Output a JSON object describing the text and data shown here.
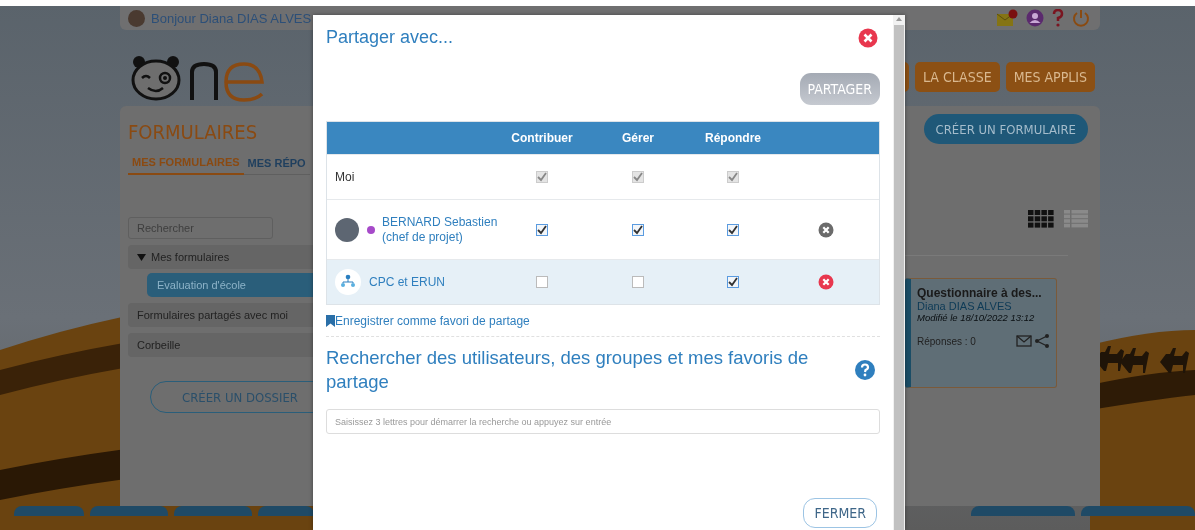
{
  "header": {
    "greeting": "Bonjour Diana DIAS ALVES"
  },
  "nav": [
    {
      "label": "LA CLASSE"
    },
    {
      "label": "MES APPLIS"
    }
  ],
  "app": {
    "title": "FORMULAIRES",
    "tabs": [
      {
        "label": "MES FORMULAIRES",
        "selected": true
      },
      {
        "label": "MES RÉPO",
        "selected": false
      }
    ],
    "search": {
      "placeholder": "Rechercher"
    },
    "tree": [
      {
        "label": "Mes formulaires",
        "expanded": true,
        "selected": false,
        "children": [
          {
            "label": "Evaluation d'école",
            "selected": true
          }
        ]
      },
      {
        "label": "Formulaires partagés avec moi",
        "selected": false
      },
      {
        "label": "Corbeille",
        "selected": false
      }
    ],
    "create_folder": "CRÉER UN DOSSIER",
    "create_form": "CRÉER UN FORMULAIRE",
    "view_modes": [
      {
        "kind": "grid",
        "selected": true
      },
      {
        "kind": "list",
        "selected": false
      }
    ],
    "cards": [
      {
        "title": "Questionnaire à des...",
        "author": "Diana DIAS ALVES",
        "modified": "Modifié le 18/10/2022 13:12",
        "responses": "Réponses : 0"
      }
    ]
  },
  "dialog": {
    "title": "Partager avec...",
    "share_button": "PARTAGER",
    "columns": [
      "Contribuer",
      "Gérer",
      "Répondre"
    ],
    "rows": [
      {
        "kind": "self",
        "name": "Moi",
        "highlighted": false,
        "removable": false,
        "rights": [
          {
            "checked": true,
            "disabled": true
          },
          {
            "checked": true,
            "disabled": true
          },
          {
            "checked": true,
            "disabled": true
          }
        ]
      },
      {
        "kind": "user",
        "name": "BERNARD Sebastien (chef de projet)",
        "color": "#a64ac9",
        "highlighted": false,
        "removable": true,
        "rights": [
          {
            "checked": true,
            "disabled": false
          },
          {
            "checked": true,
            "disabled": false
          },
          {
            "checked": true,
            "disabled": false
          }
        ]
      },
      {
        "kind": "group",
        "name": "CPC et ERUN",
        "highlighted": true,
        "removable": true,
        "rights": [
          {
            "checked": false,
            "disabled": false
          },
          {
            "checked": false,
            "disabled": false
          },
          {
            "checked": true,
            "disabled": false
          }
        ]
      }
    ],
    "favorite_link": "Enregistrer comme favori de partage",
    "search_heading": "Rechercher des utilisateurs, des groupes et mes favoris de partage",
    "search_placeholder": "Saisissez 3 lettres pour démarrer la recherche ou appuyez sur entrée",
    "close_button": "FERMER"
  }
}
